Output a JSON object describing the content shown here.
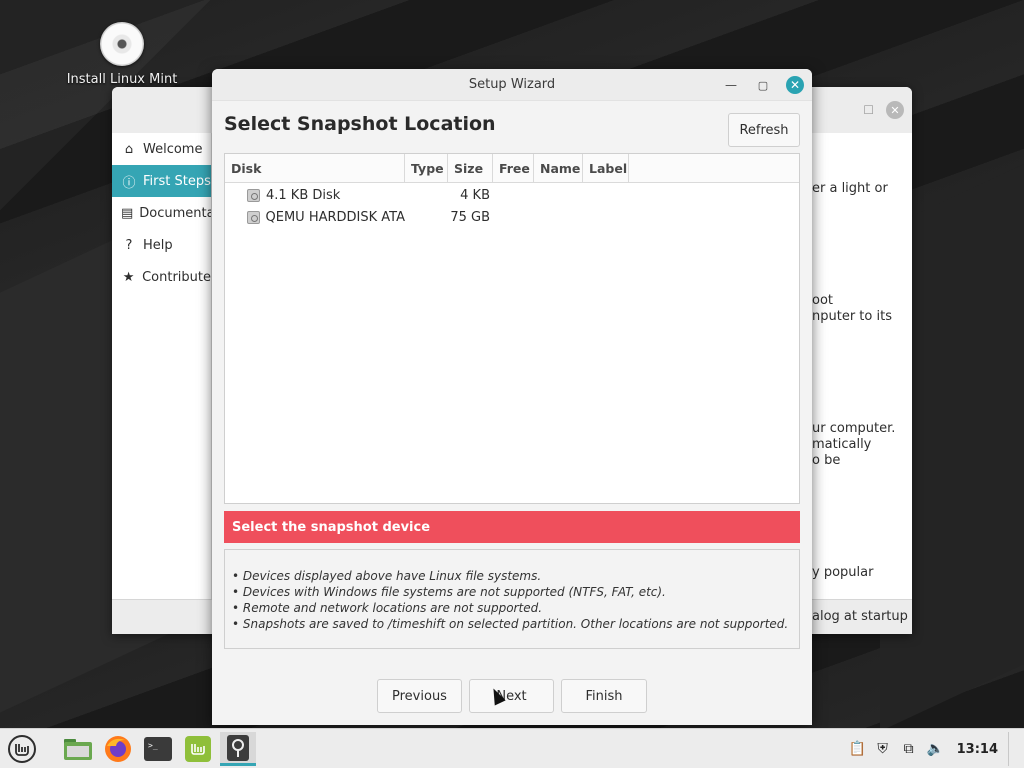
{
  "desktop": {
    "icon_label": "Install Linux Mint"
  },
  "welcome_window": {
    "sidebar": [
      {
        "label": "Welcome",
        "icon": "home-icon",
        "active": false
      },
      {
        "label": "First Steps",
        "icon": "info-icon",
        "active": true
      },
      {
        "label": "Documentation",
        "icon": "book-icon",
        "active": false
      },
      {
        "label": "Help",
        "icon": "help-icon",
        "active": false
      },
      {
        "label": "Contribute",
        "icon": "star-icon",
        "active": false
      }
    ],
    "content_fragments": [
      "er a light or",
      "oot",
      "nputer to its",
      "ur computer.",
      "matically",
      "o be",
      "y popular"
    ],
    "footer_text": "alog at startup"
  },
  "wizard": {
    "title": "Setup Wizard",
    "heading": "Select Snapshot Location",
    "refresh_label": "Refresh",
    "columns": [
      "Disk",
      "Type",
      "Size",
      "Free",
      "Name",
      "Label"
    ],
    "rows": [
      {
        "disk": "4.1 KB Disk",
        "type": "",
        "size": "4 KB",
        "free": "",
        "name": "",
        "label": ""
      },
      {
        "disk": "QEMU HARDDISK ATA",
        "type": "",
        "size": "75 GB",
        "free": "",
        "name": "",
        "label": ""
      }
    ],
    "alert": "Select the snapshot device",
    "notes": [
      "• Devices displayed above have Linux file systems.",
      "• Devices with Windows file systems are not supported (NTFS, FAT, etc).",
      "• Remote and network locations are not supported.",
      "• Snapshots are saved to /timeshift on selected partition. Other locations are not supported."
    ],
    "buttons": {
      "previous": "Previous",
      "next": "Next",
      "finish": "Finish"
    }
  },
  "taskbar": {
    "clock": "13:14",
    "accent": "#35a5b4"
  },
  "colors": {
    "alert": "#ef4f5c",
    "accent": "#35a5b4"
  }
}
